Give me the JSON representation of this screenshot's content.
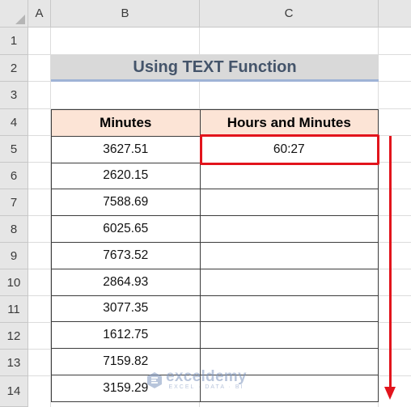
{
  "columns": [
    "A",
    "B",
    "C"
  ],
  "rows": [
    "1",
    "2",
    "3",
    "4",
    "5",
    "6",
    "7",
    "8",
    "9",
    "10",
    "11",
    "12",
    "13",
    "14"
  ],
  "title": "Using TEXT Function",
  "table": {
    "headers": [
      "Minutes",
      "Hours and Minutes"
    ],
    "rows": [
      {
        "minutes": "3627.51",
        "hours": "60:27"
      },
      {
        "minutes": "2620.15",
        "hours": ""
      },
      {
        "minutes": "7588.69",
        "hours": ""
      },
      {
        "minutes": "6025.65",
        "hours": ""
      },
      {
        "minutes": "7673.52",
        "hours": ""
      },
      {
        "minutes": "2864.93",
        "hours": ""
      },
      {
        "minutes": "3077.35",
        "hours": ""
      },
      {
        "minutes": "1612.75",
        "hours": ""
      },
      {
        "minutes": "7159.82",
        "hours": ""
      },
      {
        "minutes": "3159.29",
        "hours": ""
      }
    ]
  },
  "watermark": {
    "name": "exceldemy",
    "tagline": "EXCEL · DATA · BI"
  },
  "colors": {
    "highlight": "#e2141c",
    "header_fill": "#fce4d6",
    "title_fill": "#d9d9d9",
    "title_text": "#44546a"
  }
}
